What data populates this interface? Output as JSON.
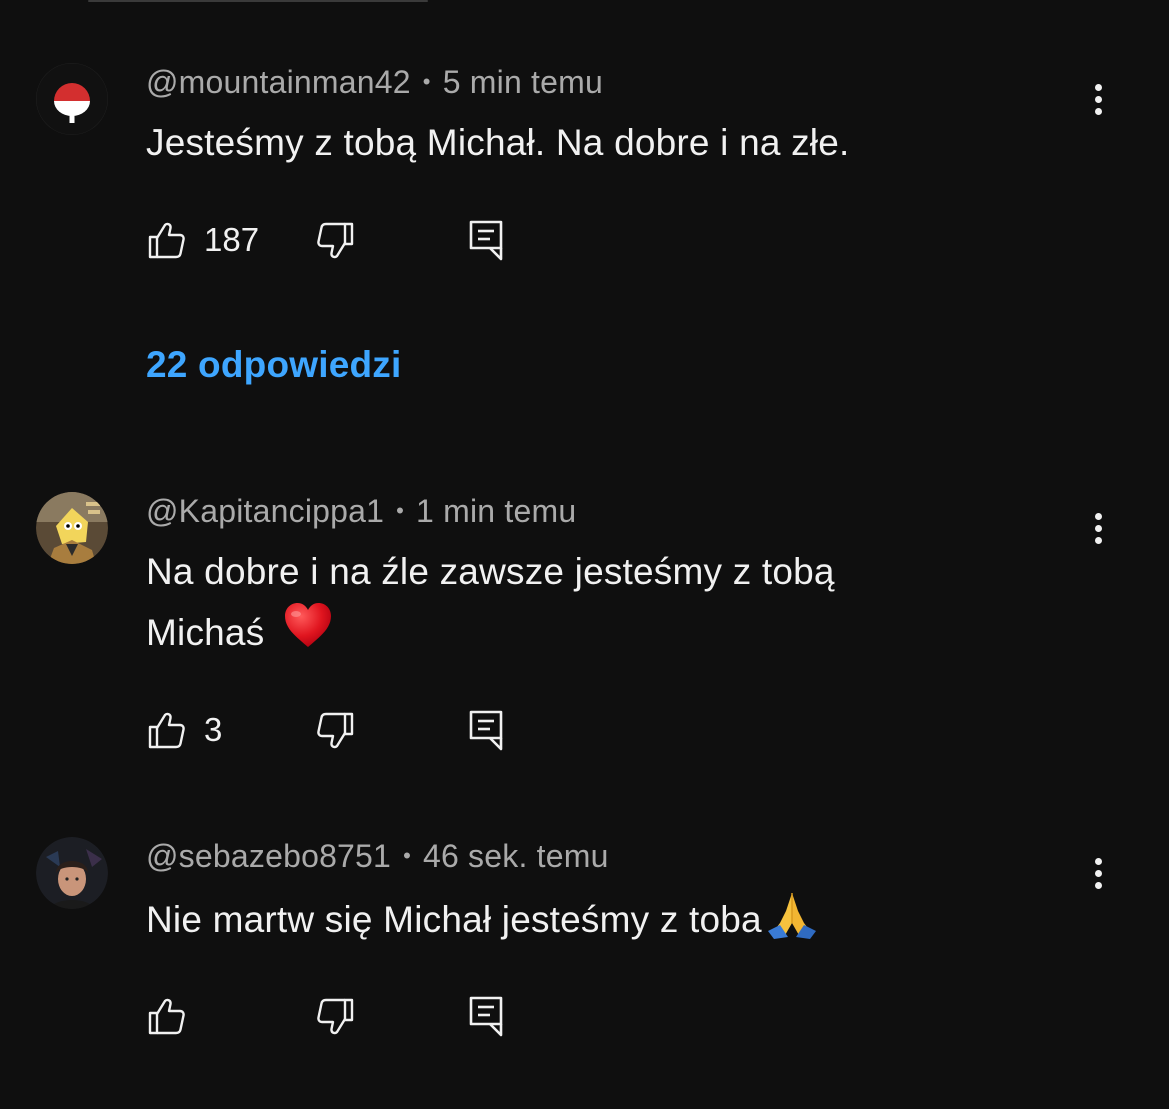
{
  "comments": [
    {
      "author": "@mountainman42",
      "time": "5 min temu",
      "text": "Jesteśmy z tobą Michał. Na dobre i  na złe.",
      "likes": "187",
      "replies_label": "22 odpowiedzi"
    },
    {
      "author": "@Kapitancippa1",
      "time": "1 min temu",
      "text_line1": "Na dobre i na źle zawsze jesteśmy z tobą",
      "text_line2": "Michaś",
      "likes": "3"
    },
    {
      "author": "@sebazebo8751",
      "time": "46 sek. temu",
      "text": "Nie martw się Michał jesteśmy z toba",
      "likes": ""
    }
  ],
  "icons": {
    "like": "thumbs-up-icon",
    "dislike": "thumbs-down-icon",
    "reply": "reply-icon",
    "menu": "more-vertical-icon"
  },
  "colors": {
    "background": "#0f0f0f",
    "text": "#f1f1f1",
    "secondary": "#aaaaaa",
    "link": "#3ea6ff"
  }
}
